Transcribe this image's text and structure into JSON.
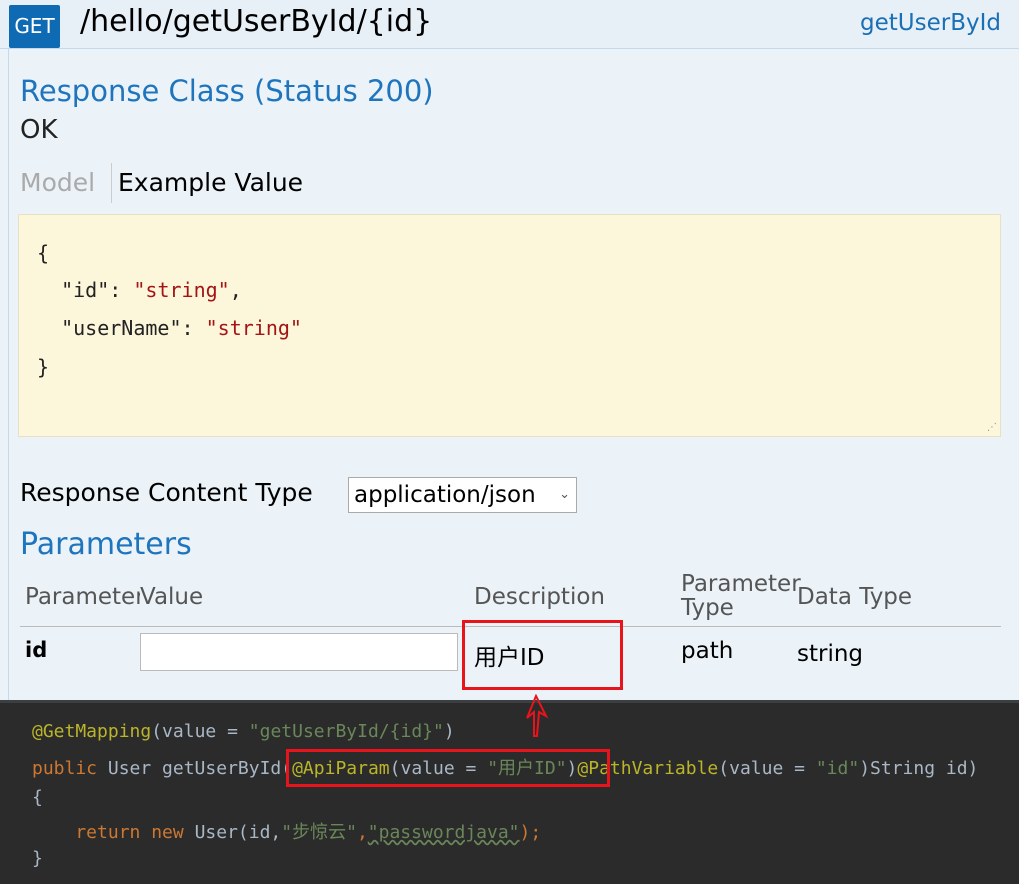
{
  "header": {
    "method": "GET",
    "path": "/hello/getUserById/{id}",
    "operation_id": "getUserById"
  },
  "response": {
    "title": "Response Class (Status 200)",
    "status_text": "OK",
    "tabs": [
      {
        "label": "Model",
        "active": false
      },
      {
        "label": "Example Value",
        "active": true
      }
    ],
    "example_lines": [
      {
        "text": "{"
      },
      {
        "key": "\"id\"",
        "sep": ": ",
        "val": "\"string\"",
        "end": ","
      },
      {
        "key": "\"userName\"",
        "sep": ": ",
        "val": "\"string\"",
        "end": ""
      },
      {
        "text": "}"
      }
    ]
  },
  "content_type": {
    "label": "Response Content Type",
    "value": "application/json"
  },
  "parameters": {
    "title": "Parameters",
    "columns": [
      "Parameter",
      "Value",
      "Description",
      "Parameter Type",
      "Data Type"
    ],
    "rows": [
      {
        "name": "id",
        "value": "",
        "description": "用户ID",
        "param_type": "path",
        "data_type": "string"
      }
    ]
  },
  "code": {
    "lines": [
      "@GetMapping(value = \"getUserById/{id}\")",
      "public User getUserById(@ApiParam(value = \"用户ID\")@PathVariable(value = \"id\")String id)",
      "{",
      "    return new User(id,\"步惊云\",\"passwordjava\");",
      "}"
    ],
    "parts": {
      "l0a": "@GetMapping",
      "l0b": "(value = ",
      "l0c": "\"getUserById/{id}\"",
      "l0d": ")",
      "l1a": "public ",
      "l1b": "User getUserById(",
      "l1c": "@ApiParam",
      "l1d": "(value = ",
      "l1e": "\"用户ID\"",
      "l1f": ")",
      "l1g": "@PathVariable",
      "l1h": "(value = ",
      "l1i": "\"id\"",
      "l1j": ")String id)",
      "l2": "{",
      "l3a": "    return new ",
      "l3b": "User(id,",
      "l3c": "\"步惊云\"",
      ",": ",",
      "l3d": "\"passwordjava\"",
      "l3e": ");",
      "l4": "}",
      "comma": ","
    }
  },
  "colors": {
    "accent": "#0f6ab4",
    "highlight": "#e8141c",
    "code_bg": "#2b2b2b"
  }
}
